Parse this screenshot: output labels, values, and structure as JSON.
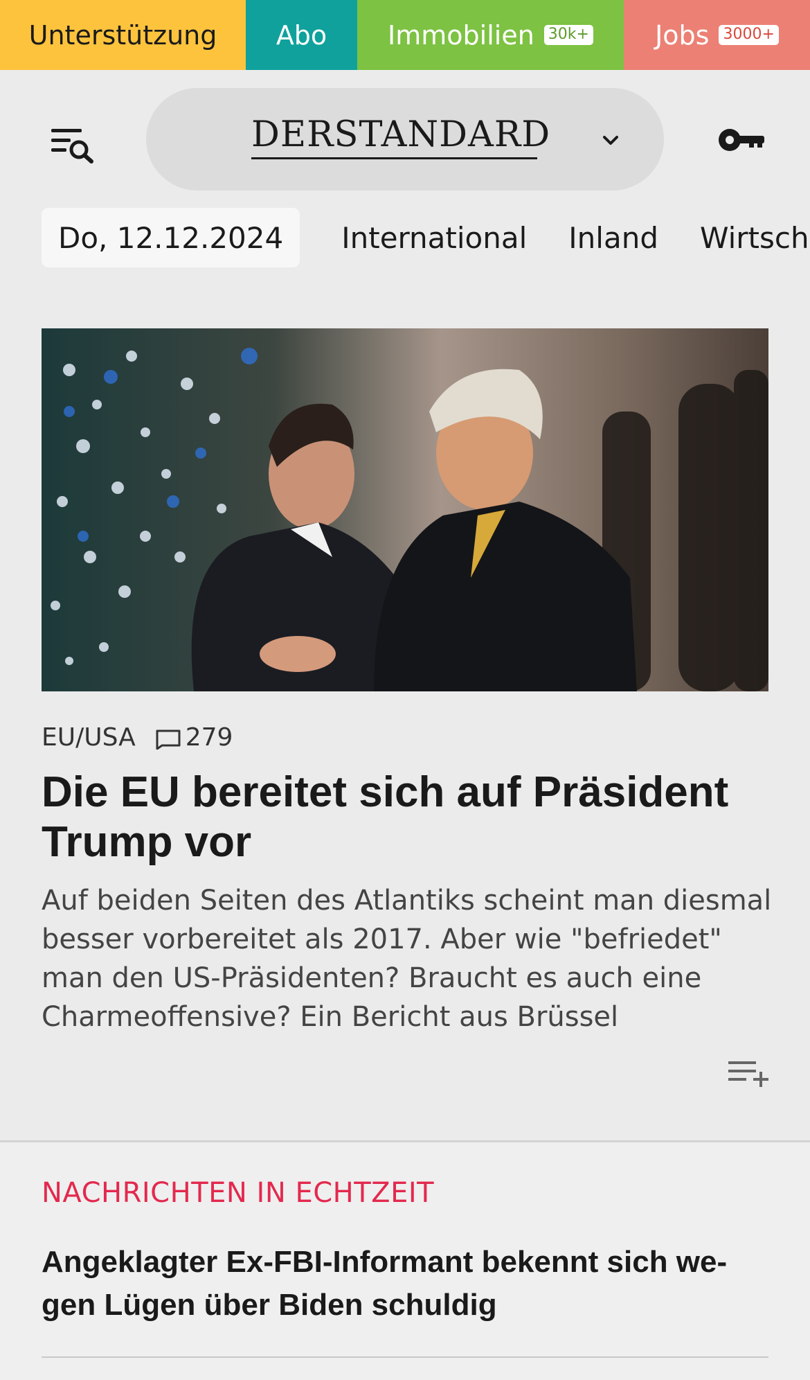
{
  "topbar": {
    "support": "Unterstützung",
    "abo": "Abo",
    "immobilien": "Immobilien",
    "immobilien_badge": "30k+",
    "jobs": "Jobs",
    "jobs_badge": "3000+",
    "colors": {
      "support": "#fdc33d",
      "abo": "#10a19c",
      "immobilien": "#7dc243",
      "jobs": "#ec8074"
    }
  },
  "header": {
    "logo": "DERSTANDARD",
    "menu_icon": "menu-search-icon",
    "chevron_icon": "chevron-down-icon",
    "key_icon": "key-icon"
  },
  "nav": {
    "date": "Do, 12.12.2024",
    "items": [
      "International",
      "Inland",
      "Wirtscha"
    ]
  },
  "article": {
    "image": "hero-photo-two-men-embracing",
    "kicker": "EU/USA",
    "comment_count": "279",
    "headline": "Die EU bereitet sich auf Präsident Trump vor",
    "teaser": "Auf beiden Seiten des Atlantiks scheint man diesmal besser vorbereitet als 2017. Aber wie \"befriedet\" man den US-Präsidenten? Braucht es auch eine Charmeoffensive? Ein Bericht aus Brüssel",
    "add_icon": "playlist-add-icon"
  },
  "realtime": {
    "label": "NACHRICHTEN IN ECHTZEIT",
    "label_color": "#e3294e",
    "headline": "Angeklagter Ex-FBI-Informant bekennt sich we-gen Lügen über Biden schuldig"
  }
}
